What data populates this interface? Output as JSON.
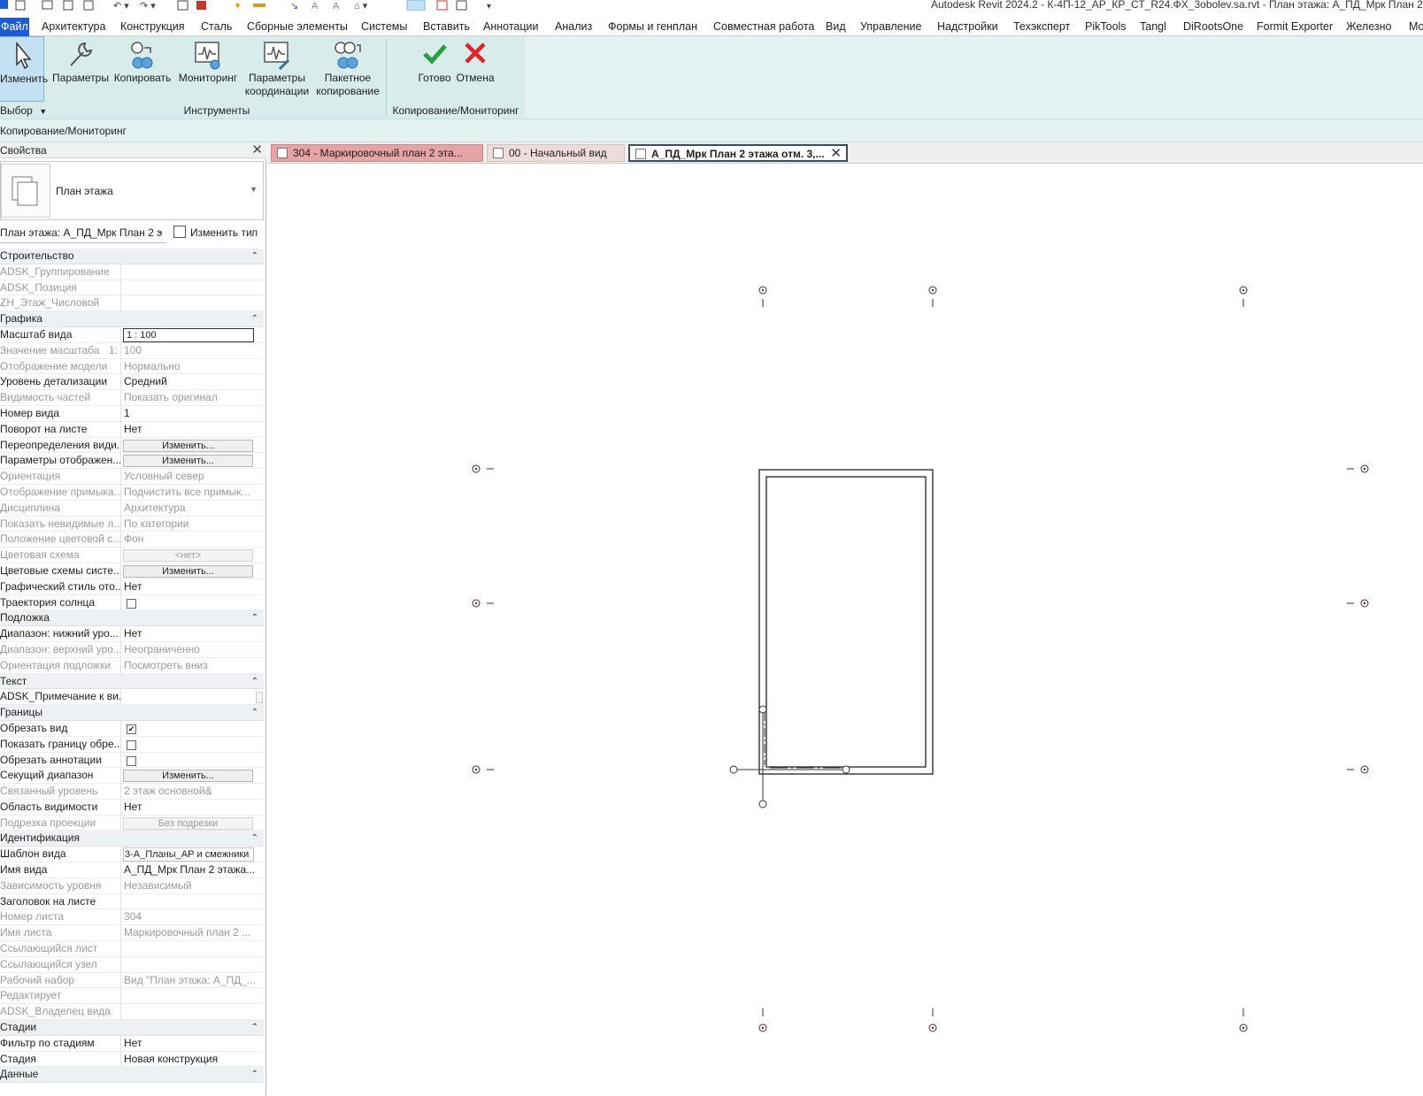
{
  "window": {
    "title": "Autodesk Revit 2024.2 - К-4П-12_АР_КР_СТ_R24.ФХ_3obolev.sa.rvt - План этажа: А_ПД_Мрк План 2 этажа"
  },
  "menu": {
    "file": "Файл",
    "items": [
      "Архитектура",
      "Конструкция",
      "Сталь",
      "Сборные элементы",
      "Системы",
      "Вставить",
      "Аннотации",
      "Анализ",
      "Формы и генплан",
      "Совместная работа",
      "Вид",
      "Управление",
      "Надстройки",
      "Техэксперт",
      "PikTools",
      "Tangl",
      "DiRootsOne",
      "Formit Exporter",
      "Железно",
      "Мо"
    ]
  },
  "ribbon": {
    "modify": "Изменить",
    "params": "Параметры",
    "copy": "Копировать",
    "monitor": "Мониторинг",
    "coord_params": [
      "Параметры",
      "координации"
    ],
    "batch_copy": [
      "Пакетное",
      "копирование"
    ],
    "finish": "Готово",
    "cancel": "Отмена",
    "panel_select": "Выбор",
    "panel_tools": "Инструменты",
    "panel_copymon": "Копирование/Мониторинг"
  },
  "context_bar": {
    "label": "Копирование/Мониторинг"
  },
  "properties": {
    "header": "Свойства",
    "type_name": "План этажа",
    "instance": "План этажа: А_ПД_Мрк План 2 э",
    "edit_type": "Изменить тип",
    "groups": [
      {
        "title": "Строительство",
        "rows": [
          {
            "k": "ADSK_Группирование",
            "v": "",
            "dis": true
          },
          {
            "k": "ADSK_Позиция",
            "v": "",
            "dis": true
          },
          {
            "k": "ZH_Этаж_Числовой",
            "v": "",
            "dis": true
          }
        ]
      },
      {
        "title": "Графика",
        "rows": [
          {
            "k": "Масштаб вида",
            "v": "1 : 100",
            "kind": "input"
          },
          {
            "k": "Значение масштаба",
            "pre": "1:",
            "v": "100",
            "dis": true
          },
          {
            "k": "Отображение модели",
            "v": "Нормально",
            "dis": true
          },
          {
            "k": "Уровень детализации",
            "v": "Средний"
          },
          {
            "k": "Видимость частей",
            "v": "Показать оригинал",
            "dis": true
          },
          {
            "k": "Номер вида",
            "v": "1"
          },
          {
            "k": "Поворот на листе",
            "v": "Нет"
          },
          {
            "k": "Переопределения види...",
            "v": "Изменить...",
            "kind": "button"
          },
          {
            "k": "Параметры отображен...",
            "v": "Изменить...",
            "kind": "button"
          },
          {
            "k": "Ориентация",
            "v": "Условный север",
            "dis": true
          },
          {
            "k": "Отображение примыка...",
            "v": "Подчистить все примык...",
            "dis": true
          },
          {
            "k": "Дисциплина",
            "v": "Архитектура",
            "dis": true
          },
          {
            "k": "Показать невидимые л...",
            "v": "По категории",
            "dis": true
          },
          {
            "k": "Положение цветовой с...",
            "v": "Фон",
            "dis": true
          },
          {
            "k": "Цветовая схема",
            "v": "<нет>",
            "kind": "button",
            "dis": true
          },
          {
            "k": "Цветовые схемы систе...",
            "v": "Изменить...",
            "kind": "button"
          },
          {
            "k": "Графический стиль ото...",
            "v": "Нет"
          },
          {
            "k": "Траектория солнца",
            "v": "",
            "kind": "checkbox",
            "checked": false
          }
        ]
      },
      {
        "title": "Подложка",
        "rows": [
          {
            "k": "Диапазон: нижний уро...",
            "v": "Нет"
          },
          {
            "k": "Диапазон: верхний уро...",
            "v": "Неограниченно",
            "dis": true
          },
          {
            "k": "Ориентация подложки",
            "v": "Посмотреть вниз",
            "dis": true
          }
        ]
      },
      {
        "title": "Текст",
        "rows": [
          {
            "k": "ADSK_Примечание к ви...",
            "v": "",
            "kind": "mini"
          }
        ]
      },
      {
        "title": "Границы",
        "rows": [
          {
            "k": "Обрезать вид",
            "v": "",
            "kind": "checkbox",
            "checked": true
          },
          {
            "k": "Показать границу обре...",
            "v": "",
            "kind": "checkbox",
            "checked": false
          },
          {
            "k": "Обрезать аннотации",
            "v": "",
            "kind": "checkbox",
            "checked": false
          },
          {
            "k": "Секущий диапазон",
            "v": "Изменить...",
            "kind": "button"
          },
          {
            "k": "Связанный уровень",
            "v": "2 этаж основной&",
            "dis": true
          },
          {
            "k": "Область видимости",
            "v": "Нет"
          },
          {
            "k": "Подрезка проекции",
            "v": "Без подрезки",
            "kind": "button",
            "dis": true
          }
        ]
      },
      {
        "title": "Идентификация",
        "rows": [
          {
            "k": "Шаблон вида",
            "v": "3-А_Планы_АР и смежники",
            "kind": "input2"
          },
          {
            "k": "Имя вида",
            "v": "А_ПД_Мрк План 2 этажа..."
          },
          {
            "k": "Зависимость уровня",
            "v": "Независимый",
            "dis": true
          },
          {
            "k": "Заголовок на листе",
            "v": ""
          },
          {
            "k": "Номер листа",
            "v": "304",
            "dis": true
          },
          {
            "k": "Имя листа",
            "v": "Маркировочный план 2 ...",
            "dis": true
          },
          {
            "k": "Ссылающийся лист",
            "v": "",
            "dis": true
          },
          {
            "k": "Ссылающийся узел",
            "v": "",
            "dis": true
          },
          {
            "k": "Рабочий набор",
            "v": "Вид \"План этажа: А_ПД_...",
            "dis": true
          },
          {
            "k": "Редактирует",
            "v": "",
            "dis": true
          },
          {
            "k": "ADSK_Владелец вида",
            "v": "",
            "dis": true
          }
        ]
      },
      {
        "title": "Стадии",
        "rows": [
          {
            "k": "Фильтр по стадиям",
            "v": "Нет"
          },
          {
            "k": "Стадия",
            "v": "Новая конструкция"
          }
        ]
      },
      {
        "title": "Данные",
        "rows": []
      }
    ]
  },
  "tabs": [
    "304 - Маркировочный план 2 эта...",
    "00 - Начальный вид",
    "А_ПД_Мрк План 2 этажа отм. 3,..."
  ],
  "colors": {
    "accent": "#1e5bd0",
    "ribbon": "#e5f2f2",
    "tab_active_border": "#3b4a5c",
    "check_green": "#2a9d3c",
    "cancel_red": "#e0242a"
  }
}
